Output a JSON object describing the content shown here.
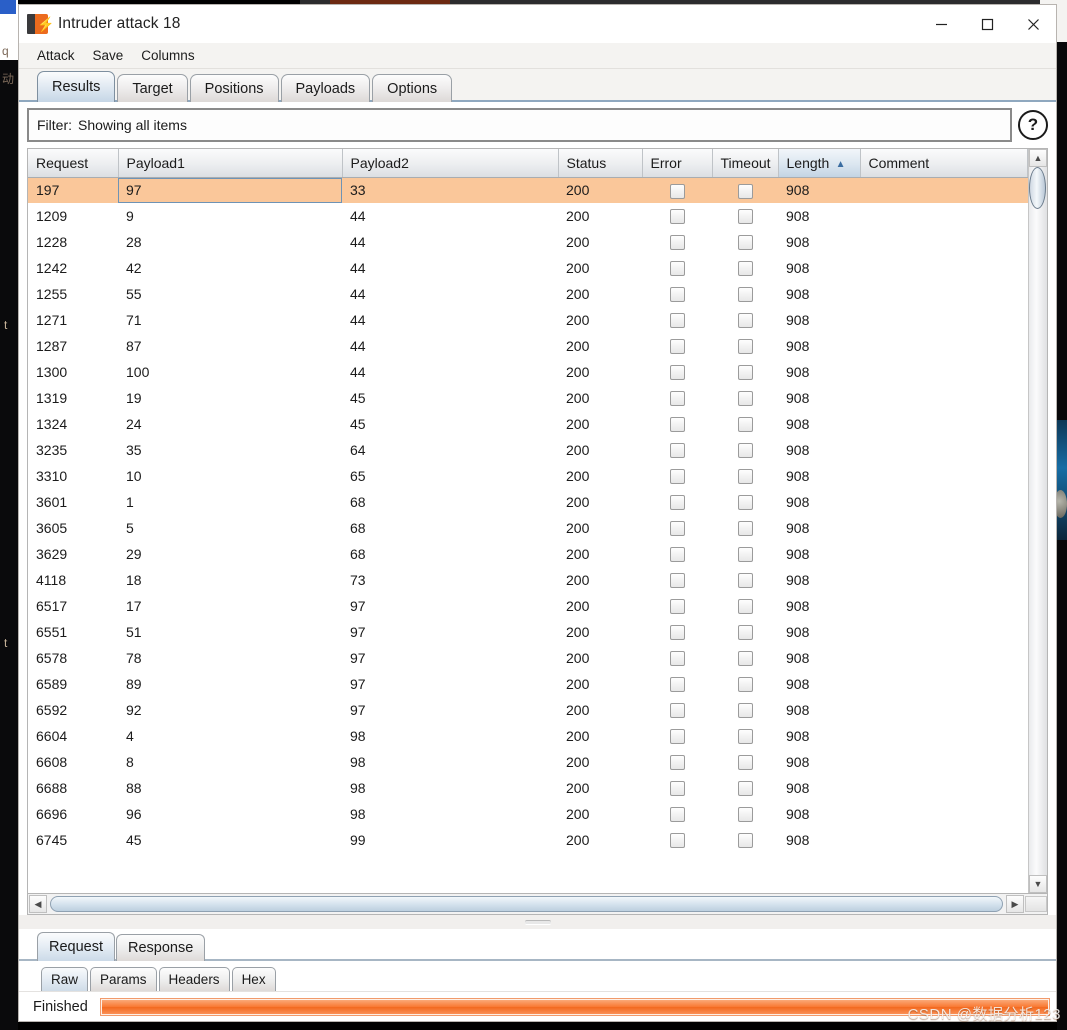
{
  "window": {
    "title": "Intruder attack 18",
    "icon": "burp-suite-icon",
    "controls": {
      "minimize": "—",
      "maximize": "□",
      "close": "✕"
    }
  },
  "menubar": {
    "items": [
      "Attack",
      "Save",
      "Columns"
    ]
  },
  "tabs": {
    "items": [
      "Results",
      "Target",
      "Positions",
      "Payloads",
      "Options"
    ],
    "active": "Results"
  },
  "filter": {
    "label": "Filter:",
    "value": "Showing all items",
    "help_icon": "?"
  },
  "table": {
    "columns": [
      "Request",
      "Payload1",
      "Payload2",
      "Status",
      "Error",
      "Timeout",
      "Length",
      "Comment"
    ],
    "sorted_column": "Length",
    "sort_direction": "▲",
    "selected_row_index": 0,
    "focused_cell_column": "Payload1",
    "rows": [
      {
        "request": "197",
        "payload1": "97",
        "payload2": "33",
        "status": "200",
        "error": false,
        "timeout": false,
        "length": "908",
        "comment": ""
      },
      {
        "request": "1209",
        "payload1": "9",
        "payload2": "44",
        "status": "200",
        "error": false,
        "timeout": false,
        "length": "908",
        "comment": ""
      },
      {
        "request": "1228",
        "payload1": "28",
        "payload2": "44",
        "status": "200",
        "error": false,
        "timeout": false,
        "length": "908",
        "comment": ""
      },
      {
        "request": "1242",
        "payload1": "42",
        "payload2": "44",
        "status": "200",
        "error": false,
        "timeout": false,
        "length": "908",
        "comment": ""
      },
      {
        "request": "1255",
        "payload1": "55",
        "payload2": "44",
        "status": "200",
        "error": false,
        "timeout": false,
        "length": "908",
        "comment": ""
      },
      {
        "request": "1271",
        "payload1": "71",
        "payload2": "44",
        "status": "200",
        "error": false,
        "timeout": false,
        "length": "908",
        "comment": ""
      },
      {
        "request": "1287",
        "payload1": "87",
        "payload2": "44",
        "status": "200",
        "error": false,
        "timeout": false,
        "length": "908",
        "comment": ""
      },
      {
        "request": "1300",
        "payload1": "100",
        "payload2": "44",
        "status": "200",
        "error": false,
        "timeout": false,
        "length": "908",
        "comment": ""
      },
      {
        "request": "1319",
        "payload1": "19",
        "payload2": "45",
        "status": "200",
        "error": false,
        "timeout": false,
        "length": "908",
        "comment": ""
      },
      {
        "request": "1324",
        "payload1": "24",
        "payload2": "45",
        "status": "200",
        "error": false,
        "timeout": false,
        "length": "908",
        "comment": ""
      },
      {
        "request": "3235",
        "payload1": "35",
        "payload2": "64",
        "status": "200",
        "error": false,
        "timeout": false,
        "length": "908",
        "comment": ""
      },
      {
        "request": "3310",
        "payload1": "10",
        "payload2": "65",
        "status": "200",
        "error": false,
        "timeout": false,
        "length": "908",
        "comment": ""
      },
      {
        "request": "3601",
        "payload1": "1",
        "payload2": "68",
        "status": "200",
        "error": false,
        "timeout": false,
        "length": "908",
        "comment": ""
      },
      {
        "request": "3605",
        "payload1": "5",
        "payload2": "68",
        "status": "200",
        "error": false,
        "timeout": false,
        "length": "908",
        "comment": ""
      },
      {
        "request": "3629",
        "payload1": "29",
        "payload2": "68",
        "status": "200",
        "error": false,
        "timeout": false,
        "length": "908",
        "comment": ""
      },
      {
        "request": "4118",
        "payload1": "18",
        "payload2": "73",
        "status": "200",
        "error": false,
        "timeout": false,
        "length": "908",
        "comment": ""
      },
      {
        "request": "6517",
        "payload1": "17",
        "payload2": "97",
        "status": "200",
        "error": false,
        "timeout": false,
        "length": "908",
        "comment": ""
      },
      {
        "request": "6551",
        "payload1": "51",
        "payload2": "97",
        "status": "200",
        "error": false,
        "timeout": false,
        "length": "908",
        "comment": ""
      },
      {
        "request": "6578",
        "payload1": "78",
        "payload2": "97",
        "status": "200",
        "error": false,
        "timeout": false,
        "length": "908",
        "comment": ""
      },
      {
        "request": "6589",
        "payload1": "89",
        "payload2": "97",
        "status": "200",
        "error": false,
        "timeout": false,
        "length": "908",
        "comment": ""
      },
      {
        "request": "6592",
        "payload1": "92",
        "payload2": "97",
        "status": "200",
        "error": false,
        "timeout": false,
        "length": "908",
        "comment": ""
      },
      {
        "request": "6604",
        "payload1": "4",
        "payload2": "98",
        "status": "200",
        "error": false,
        "timeout": false,
        "length": "908",
        "comment": ""
      },
      {
        "request": "6608",
        "payload1": "8",
        "payload2": "98",
        "status": "200",
        "error": false,
        "timeout": false,
        "length": "908",
        "comment": ""
      },
      {
        "request": "6688",
        "payload1": "88",
        "payload2": "98",
        "status": "200",
        "error": false,
        "timeout": false,
        "length": "908",
        "comment": ""
      },
      {
        "request": "6696",
        "payload1": "96",
        "payload2": "98",
        "status": "200",
        "error": false,
        "timeout": false,
        "length": "908",
        "comment": ""
      },
      {
        "request": "6745",
        "payload1": "45",
        "payload2": "99",
        "status": "200",
        "error": false,
        "timeout": false,
        "length": "908",
        "comment": ""
      }
    ]
  },
  "scrollbars": {
    "vertical": {
      "up_arrow": "▲",
      "down_arrow": "▼"
    },
    "horizontal": {
      "left_arrow": "◀",
      "right_arrow": "▶"
    }
  },
  "message_tabs": {
    "items": [
      "Request",
      "Response"
    ],
    "active": "Request"
  },
  "view_tabs": {
    "items": [
      "Raw",
      "Params",
      "Headers",
      "Hex"
    ],
    "active": "Raw"
  },
  "statusbar": {
    "status": "Finished",
    "progress_percent": 100
  },
  "watermark": "CSDN @数据分析123",
  "colors": {
    "selected_row": "#FAC79A",
    "progress_bar": "#F97A34",
    "accent_icon": "#EC6B1E",
    "sort_arrow": "#3A6DA1"
  }
}
